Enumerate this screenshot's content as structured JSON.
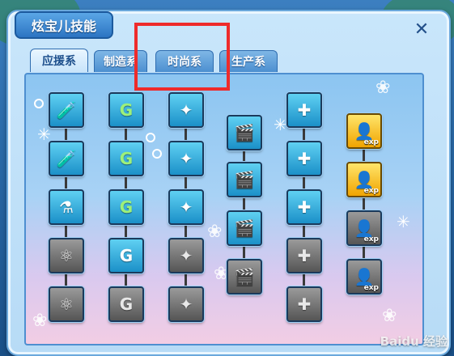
{
  "window": {
    "title": "炫宝儿技能",
    "close_glyph": "✕"
  },
  "tabs": [
    {
      "label": "应援系",
      "active": true
    },
    {
      "label": "制造系",
      "active": false
    },
    {
      "label": "时尚系",
      "active": false
    },
    {
      "label": "生产系",
      "active": false
    }
  ],
  "skill_tree": {
    "columns": [
      {
        "name": "应援系-试管",
        "nodes": [
          {
            "icon": "test-tube-icon",
            "glyph": "🧪",
            "state": "on"
          },
          {
            "icon": "test-tubes-icon",
            "glyph": "🧪",
            "state": "on"
          },
          {
            "icon": "flasks-icon",
            "glyph": "⚗",
            "state": "on"
          },
          {
            "icon": "molecule-icon",
            "glyph": "⚛",
            "state": "off"
          },
          {
            "icon": "molecule-cluster-icon",
            "glyph": "⚛",
            "state": "off"
          }
        ]
      },
      {
        "name": "制造系-G币",
        "nodes": [
          {
            "icon": "g-coin-icon",
            "glyph": "G",
            "state": "on"
          },
          {
            "icon": "g-coins-icon",
            "glyph": "G",
            "state": "on"
          },
          {
            "icon": "g-coin-pile-icon",
            "glyph": "G",
            "state": "on"
          },
          {
            "icon": "orange-coins-icon",
            "glyph": "G",
            "state": "on"
          },
          {
            "icon": "gray-coins-icon",
            "glyph": "G",
            "state": "off"
          }
        ]
      },
      {
        "name": "星章",
        "nodes": [
          {
            "icon": "green-star-badge-icon",
            "glyph": "✦",
            "state": "on"
          },
          {
            "icon": "silver-star-badge-icon",
            "glyph": "✦",
            "state": "on"
          },
          {
            "icon": "silver-star-badge-2-icon",
            "glyph": "✦",
            "state": "on"
          },
          {
            "icon": "gray-star-badge-icon",
            "glyph": "✦",
            "state": "off"
          },
          {
            "icon": "gray-star-badge-2-icon",
            "glyph": "✦",
            "state": "off"
          }
        ]
      },
      {
        "name": "时尚系-场记板",
        "nodes": [
          {
            "icon": "green-clapboard-icon",
            "glyph": "🎬",
            "state": "on"
          },
          {
            "icon": "blue-clapboard-icon",
            "glyph": "🎬",
            "state": "on"
          },
          {
            "icon": "orange-clapboard-icon",
            "glyph": "🎬",
            "state": "on"
          },
          {
            "icon": "gray-clapboard-icon",
            "glyph": "🎬",
            "state": "off"
          }
        ]
      },
      {
        "name": "医药箱",
        "nodes": [
          {
            "icon": "medical-plus-icon",
            "glyph": "✚",
            "state": "on"
          },
          {
            "icon": "medical-plus-2-icon",
            "glyph": "✚",
            "state": "on"
          },
          {
            "icon": "medical-kit-icon",
            "glyph": "✚",
            "state": "on"
          },
          {
            "icon": "gray-medical-kit-icon",
            "glyph": "✚",
            "state": "off"
          },
          {
            "icon": "gray-medical-kit-2-icon",
            "glyph": "✚",
            "state": "off"
          }
        ]
      },
      {
        "name": "exp",
        "nodes": [
          {
            "icon": "gold-exp-person-icon",
            "glyph": "👤",
            "state": "gold",
            "label": "exp"
          },
          {
            "icon": "gold-exp-person-2-icon",
            "glyph": "👤",
            "state": "gold",
            "label": "exp"
          },
          {
            "icon": "gray-exp-person-icon",
            "glyph": "👤",
            "state": "off",
            "label": "exp"
          },
          {
            "icon": "gray-exp-person-2-icon",
            "glyph": "👤",
            "state": "off",
            "label": "exp"
          }
        ]
      }
    ]
  },
  "watermark": "Baidu 经验",
  "colors": {
    "highlight": "#ee2b2b",
    "panel": "#b7dbf6",
    "tab_active_text": "#1d4f8c"
  }
}
